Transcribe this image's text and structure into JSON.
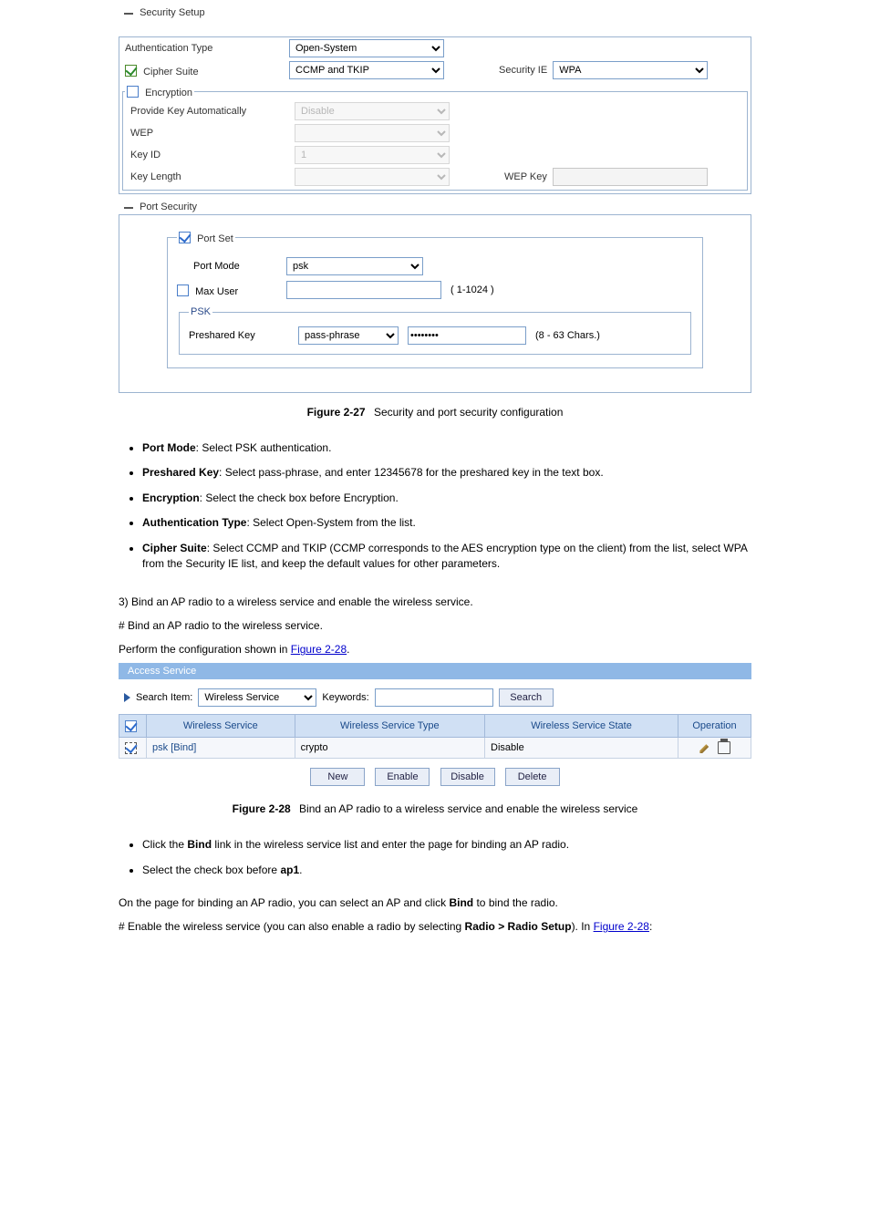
{
  "security_panel": {
    "header": "Security Setup",
    "auth_label": "Authentication Type",
    "auth_value": "Open-System",
    "cipher_label": "Cipher Suite",
    "cipher_value": "CCMP and TKIP",
    "security_ie_label": "Security IE",
    "security_ie_value": "WPA",
    "encryption_header": "Encryption",
    "provide_key_label": "Provide Key Automatically",
    "provide_key_value": "Disable",
    "wep_label": "WEP",
    "wep_value": "",
    "keyid_label": "Key ID",
    "keyid_value": "1",
    "keylen_label": "Key Length",
    "keylen_value": "",
    "wepkey_label": "WEP Key",
    "wepkey_value": ""
  },
  "port_panel": {
    "header": "Port Security",
    "portset_label": "Port Set",
    "portmode_label": "Port Mode",
    "portmode_value": "psk",
    "maxuser_label": "Max User",
    "maxuser_value": "",
    "maxuser_hint": "( 1-1024 )",
    "psk_label": "PSK",
    "preshared_label": "Preshared Key",
    "preshared_type": "pass-phrase",
    "preshared_value": "********",
    "preshared_hint": "(8 - 63 Chars.)"
  },
  "figure1": {
    "num": "Figure 2-27",
    "text": "Security and port security configuration"
  },
  "bullets1": [
    {
      "b": "Port Mode",
      "t": ": Select PSK authentication."
    },
    {
      "b": "Preshared Key",
      "t": ": Select pass-phrase, and enter 12345678 for the preshared key in the text box."
    },
    {
      "b": "Encryption",
      "t": ": Select the check box before Encryption."
    },
    {
      "b": "Authentication Type",
      "t": ": Select Open-System from the list."
    },
    {
      "b": "Cipher Suite",
      "t": ": Select CCMP and TKIP (CCMP corresponds to the AES encryption type on the client) from the list, select WPA from the Security IE list, and keep the default values for other parameters."
    }
  ],
  "heading_bind": "3)        Bind an AP radio to a wireless service and enable the wireless service.",
  "step1_line1": "# Bind an AP radio to the wireless service.",
  "step1_line2": "Perform the configuration shown in ",
  "step1_link": "Figure 2-28",
  "step1_line3": ".",
  "access_service": {
    "tab": "Access Service",
    "search_item_label": "Search Item:",
    "search_item_value": "Wireless Service",
    "keywords_label": "Keywords:",
    "keywords_value": "",
    "search_btn": "Search",
    "cols": {
      "svc": "Wireless Service",
      "type": "Wireless Service Type",
      "state": "Wireless Service State",
      "op": "Operation"
    },
    "rows": [
      {
        "svc": "psk",
        "bind": "[Bind]",
        "type": "crypto",
        "state": "Disable"
      }
    ],
    "btn_new": "New",
    "btn_enable": "Enable",
    "btn_disable": "Disable",
    "btn_delete": "Delete"
  },
  "figure2": {
    "num": "Figure 2-28",
    "text": "Bind an AP radio to a wireless service and enable the wireless service"
  },
  "bullets2": [
    {
      "t1": "Click the ",
      "b": "Bind",
      "t2": " link in the wireless service list and enter the page for binding an AP radio."
    },
    {
      "t1": "Select the check box before ",
      "b": "ap1",
      "t2": "."
    }
  ],
  "tail1": "On the page for binding an AP radio, you can select an AP and click ",
  "tail_bold": "Bind",
  "tail2": " to bind the radio.",
  "tail3a": "# Enable the wireless service (you can also enable a radio by selecting ",
  "tail3b": "Radio > Radio Setup",
  "tail3c": "). In",
  "tail_ref": "Figure 2-28",
  "tail4": ":"
}
